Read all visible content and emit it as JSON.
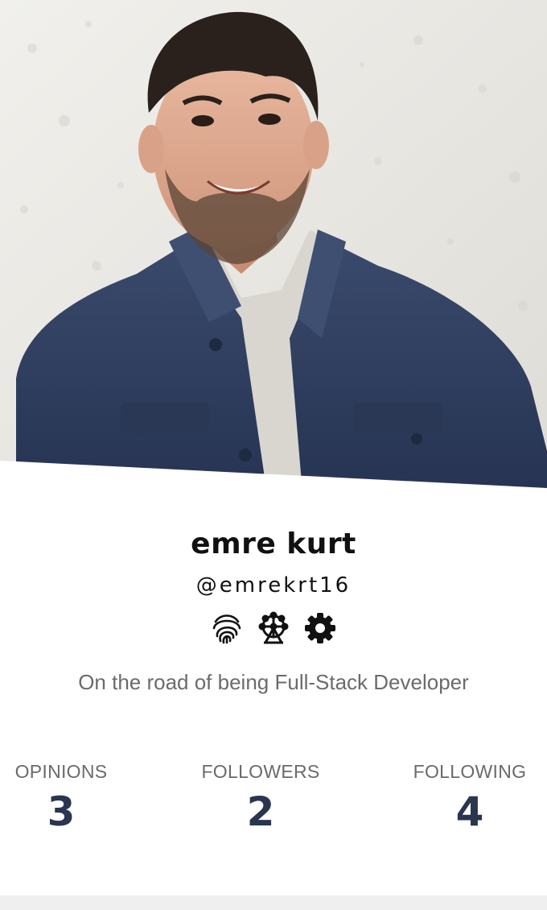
{
  "profile": {
    "name": "emre kurt",
    "handle": "@emrekrt16",
    "bio": "On the road of being Full-Stack Developer",
    "badges": [
      {
        "icon": "fingerprint-icon"
      },
      {
        "icon": "ferris-wheel-icon"
      },
      {
        "icon": "gear-icon"
      }
    ]
  },
  "stats": [
    {
      "label": "OPINIONS",
      "value": "3"
    },
    {
      "label": "FOLLOWERS",
      "value": "2"
    },
    {
      "label": "FOLLOWING",
      "value": "4"
    }
  ],
  "colors": {
    "stat_value": "#2a3550",
    "stat_label": "#6a6a6a",
    "bio": "#6b6b6b",
    "jacket": "#2e3d5c",
    "wall": "#e9e8e4"
  }
}
